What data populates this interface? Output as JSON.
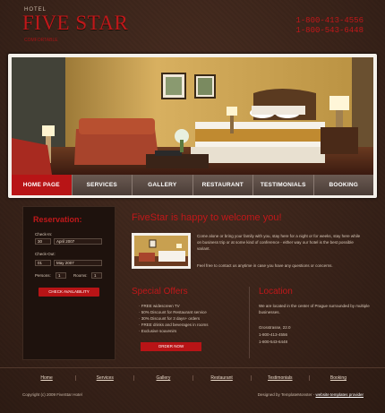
{
  "header": {
    "logo_small": "HOTEL",
    "logo_main": "FIVE STAR",
    "logo_tagline": "COMFORTABLE",
    "phone1": "1-800-413-4556",
    "phone2": "1-800-543-6448"
  },
  "nav": [
    "HOME PAGE",
    "SERVICES",
    "GALLERY",
    "RESTAURANT",
    "TESTIMONIALS",
    "BOOKING"
  ],
  "reservation": {
    "title": "Reservation:",
    "check_in_label": "Check-In:",
    "check_in_day": "30",
    "check_in_month": "April 2007",
    "check_out_label": "Check-Out:",
    "check_out_day": "01",
    "check_out_month": "May 2007",
    "persons_label": "Persons:",
    "persons_value": "1",
    "rooms_label": "Rooms:",
    "rooms_value": "1",
    "button": "CHECK AVAILABILITY"
  },
  "welcome": {
    "title": "FiveStar is happy to welcome you!",
    "text": "Come alone or bring your family with you, stay here for a night or for weeks, stay here while on business trip or at some kind of conference - either way our hotel is the best possible variant.",
    "text2": "Feel free to contact us anytime in case you have any questions or concerns."
  },
  "offers": {
    "title": "Special Offers",
    "items": [
      "FREE widescreen TV",
      "50% Discount for Restaurant service",
      "30% Discount for 3 days+ orders",
      "FREE drinks and beverages in rooms",
      "Exclusive souvenirs"
    ],
    "button": "ORDER NOW"
  },
  "location": {
    "title": "Location",
    "text": "We are located in the center of Prague surrounded by multiple businesses.",
    "address": "Grosstrasse, 22.0",
    "phone1": "1-800-413-4556",
    "phone2": "1-800-543-6448"
  },
  "footer": {
    "links": [
      "Home",
      "Services",
      "Gallery",
      "Restaurant",
      "Testimonials",
      "Booking"
    ],
    "copyright": "Copyright (c) 2009 FiveStar Hotel",
    "designed_by": "Designed by TemplateMonster - ",
    "designer_link": "website templates provider"
  }
}
